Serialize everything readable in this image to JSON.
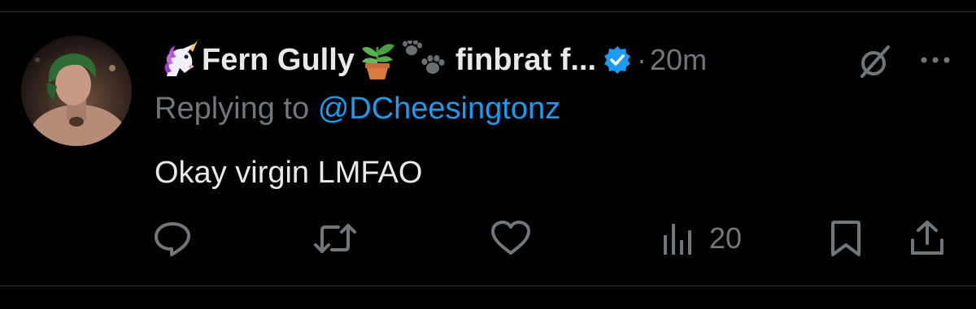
{
  "tweet": {
    "author": {
      "name_part1": "Fern Gully",
      "name_part2": "finbrat f...",
      "emojis": [
        "unicorn-emoji",
        "potted-plant-emoji",
        "paw-prints-emoji"
      ],
      "verified": true
    },
    "timestamp": "20m",
    "separator": "·",
    "replying_to_prefix": "Replying to",
    "replying_to_handle": "@DCheesingtonz",
    "text": "Okay virgin LMFAO"
  },
  "actions": {
    "reply": {
      "icon": "reply-icon",
      "count": ""
    },
    "retweet": {
      "icon": "retweet-icon",
      "count": ""
    },
    "like": {
      "icon": "heart-icon",
      "count": ""
    },
    "views": {
      "icon": "views-icon",
      "count": "20"
    },
    "bookmark": {
      "icon": "bookmark-icon"
    },
    "share": {
      "icon": "share-icon"
    }
  },
  "colors": {
    "background": "#000000",
    "text": "#e7e9ea",
    "muted": "#71767b",
    "link": "#1d9bf0",
    "verified": "#1d9bf0",
    "divider": "#2f3336"
  }
}
